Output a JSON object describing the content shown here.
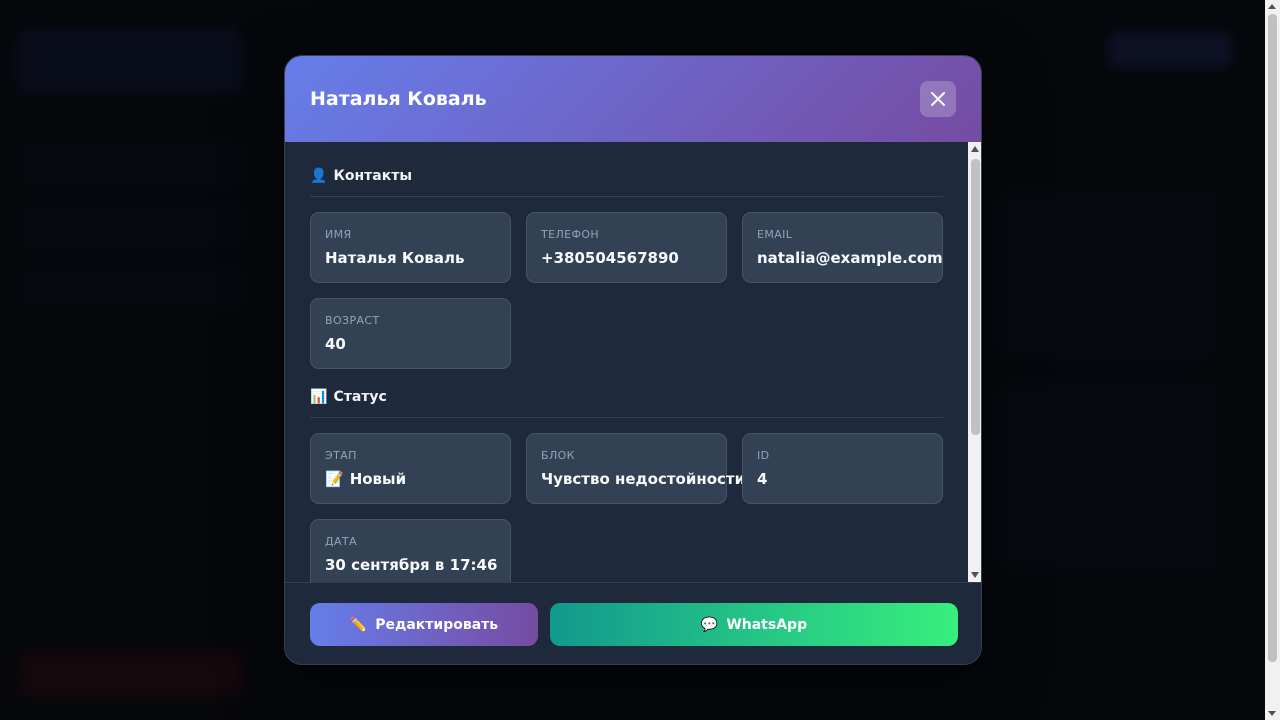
{
  "modal": {
    "title": "Наталья Коваль",
    "close_icon": "close-icon"
  },
  "sections": {
    "contacts": {
      "icon": "👤",
      "title": "Контакты",
      "fields": [
        {
          "label": "Имя",
          "value": "Наталья Коваль"
        },
        {
          "label": "Телефон",
          "value": "+380504567890"
        },
        {
          "label": "Email",
          "value": "natalia@example.com"
        },
        {
          "label": "Возраст",
          "value": "40"
        }
      ]
    },
    "status": {
      "icon": "📊",
      "title": "Статус",
      "fields": [
        {
          "label": "Этап",
          "icon": "📝",
          "value": "Новый"
        },
        {
          "label": "Блок",
          "value": "Чувство недостойности"
        },
        {
          "label": "ID",
          "value": "4"
        },
        {
          "label": "Дата",
          "value": "30 сентября в 17:46"
        }
      ]
    }
  },
  "footer": {
    "edit_icon": "✏️",
    "edit_label": "Редактировать",
    "whatsapp_icon": "💬",
    "whatsapp_label": "WhatsApp"
  },
  "colors": {
    "header_gradient_start": "#667eea",
    "header_gradient_end": "#764ba2",
    "whatsapp_gradient_start": "#11998e",
    "whatsapp_gradient_end": "#38ef7d",
    "modal_bg": "#1e293b",
    "field_bg": "#334155"
  }
}
